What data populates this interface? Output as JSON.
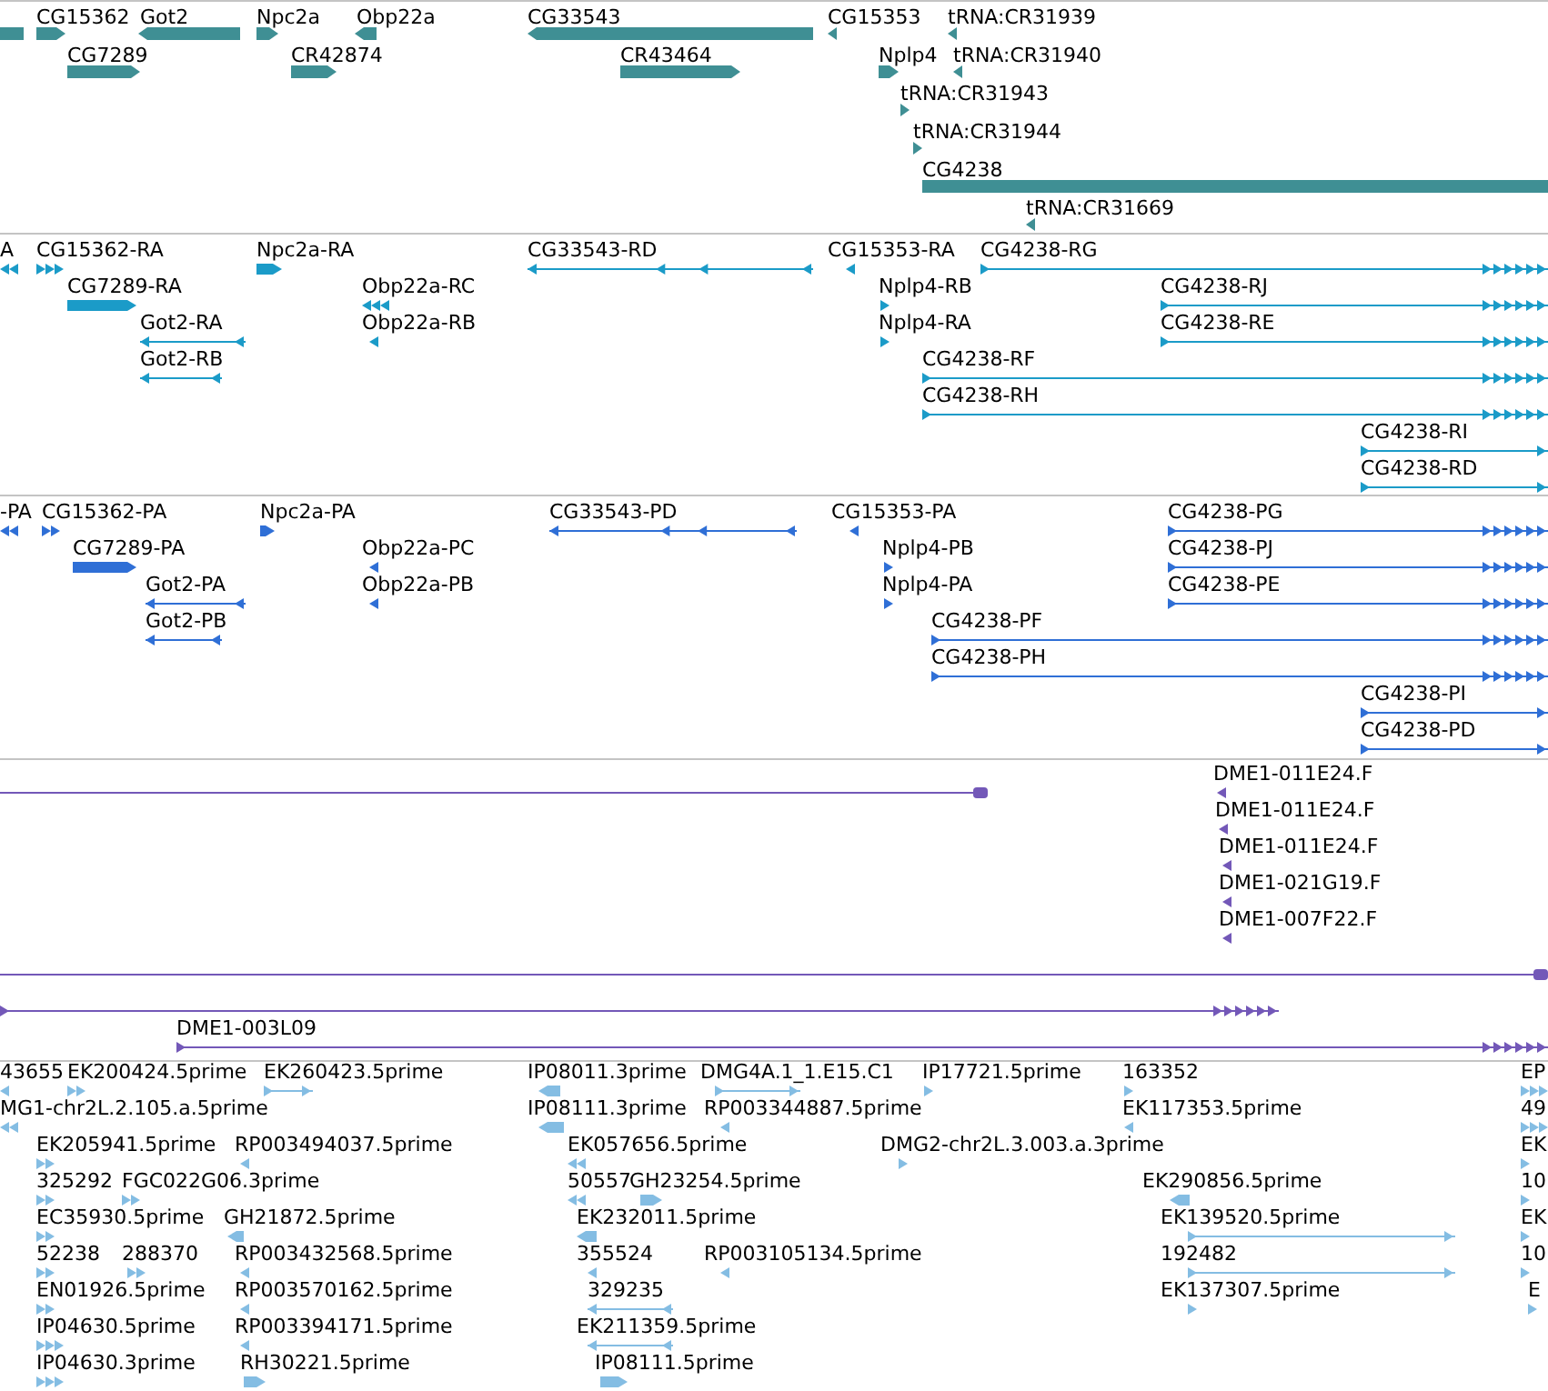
{
  "tracks": [
    {
      "color": "#3f8f94",
      "features": [
        {
          "kind": "plain"
        },
        {
          "label": "CG15362",
          "kind": "forward"
        },
        {
          "label": "Got2",
          "kind": "reverse"
        },
        {
          "label": "Npc2a",
          "kind": "forward"
        },
        {
          "label": "Obp22a",
          "kind": "reverse"
        },
        {
          "label": "CG33543",
          "kind": "reverse"
        },
        {
          "label": "CG15353",
          "kind": "reverse"
        },
        {
          "label": "tRNA:CR31939",
          "kind": "reverse"
        },
        {
          "label": "CG7289",
          "kind": "forward"
        },
        {
          "label": "CR42874",
          "kind": "forward"
        },
        {
          "label": "CR43464",
          "kind": "forward"
        },
        {
          "label": "Nplp4",
          "kind": "forward"
        },
        {
          "label": "tRNA:CR31940",
          "kind": "reverse"
        },
        {
          "label": "tRNA:CR31943",
          "kind": "forward"
        },
        {
          "label": "tRNA:CR31944",
          "kind": "forward"
        },
        {
          "label": "CG4238",
          "kind": "plain"
        },
        {
          "label": "tRNA:CR31669",
          "kind": "reverse"
        }
      ]
    },
    {
      "color": "#1b9bc8",
      "features": [
        {
          "label": "A",
          "kind": "reverse"
        },
        {
          "label": "CG15362-RA",
          "kind": "forward"
        },
        {
          "label": "Npc2a-RA",
          "kind": "forward"
        },
        {
          "label": "CG33543-RD",
          "kind": "reverse"
        },
        {
          "label": "CG15353-RA",
          "kind": "reverse"
        },
        {
          "label": "CG4238-RG",
          "kind": "forward"
        },
        {
          "label": "CG7289-RA",
          "kind": "forward"
        },
        {
          "label": "Obp22a-RC",
          "kind": "reverse"
        },
        {
          "label": "Nplp4-RB",
          "kind": "forward"
        },
        {
          "label": "CG4238-RJ",
          "kind": "forward"
        },
        {
          "label": "Got2-RA",
          "kind": "reverse"
        },
        {
          "label": "Obp22a-RB",
          "kind": "reverse"
        },
        {
          "label": "Nplp4-RA",
          "kind": "forward"
        },
        {
          "label": "CG4238-RE",
          "kind": "forward"
        },
        {
          "label": "Got2-RB",
          "kind": "reverse"
        },
        {
          "label": "CG4238-RF",
          "kind": "forward"
        },
        {
          "label": "CG4238-RH",
          "kind": "forward"
        },
        {
          "label": "CG4238-RI",
          "kind": "forward"
        },
        {
          "label": "CG4238-RD",
          "kind": "forward"
        }
      ]
    },
    {
      "color": "#2f6fd6",
      "features": [
        {
          "label": "-PA",
          "kind": "reverse"
        },
        {
          "label": "CG15362-PA",
          "kind": "forward"
        },
        {
          "label": "Npc2a-PA",
          "kind": "forward"
        },
        {
          "label": "CG33543-PD",
          "kind": "reverse"
        },
        {
          "label": "CG15353-PA",
          "kind": "reverse"
        },
        {
          "label": "CG4238-PG",
          "kind": "forward"
        },
        {
          "label": "CG7289-PA",
          "kind": "forward"
        },
        {
          "label": "Obp22a-PC",
          "kind": "reverse"
        },
        {
          "label": "Nplp4-PB",
          "kind": "forward"
        },
        {
          "label": "CG4238-PJ",
          "kind": "forward"
        },
        {
          "label": "Got2-PA",
          "kind": "reverse"
        },
        {
          "label": "Obp22a-PB",
          "kind": "reverse"
        },
        {
          "label": "Nplp4-PA",
          "kind": "forward"
        },
        {
          "label": "CG4238-PE",
          "kind": "forward"
        },
        {
          "label": "Got2-PB",
          "kind": "reverse"
        },
        {
          "label": "CG4238-PF",
          "kind": "forward"
        },
        {
          "label": "CG4238-PH",
          "kind": "forward"
        },
        {
          "label": "CG4238-PI",
          "kind": "forward"
        },
        {
          "label": "CG4238-PD",
          "kind": "forward"
        }
      ]
    },
    {
      "color": "#7358b8",
      "features": [
        {
          "kind": "plain"
        },
        {
          "label": "DME1-011E24.F",
          "kind": "reverse"
        },
        {
          "label": "DME1-011E24.F",
          "kind": "reverse"
        },
        {
          "label": "DME1-011E24.F",
          "kind": "reverse"
        },
        {
          "label": "DME1-021G19.F",
          "kind": "reverse"
        },
        {
          "label": "DME1-007F22.F",
          "kind": "reverse"
        },
        {
          "kind": "plain"
        },
        {
          "kind": "forward"
        },
        {
          "label": "DME1-003L09",
          "kind": "forward"
        }
      ]
    },
    {
      "color": "#84bde3",
      "features": [
        {
          "label": "43655",
          "kind": "reverse"
        },
        {
          "label": "EK200424.5prime",
          "kind": "forward"
        },
        {
          "label": "EK260423.5prime",
          "kind": "forward"
        },
        {
          "label": "IP08011.3prime",
          "kind": "reverse"
        },
        {
          "label": "DMG4A.1_1.E15.C1",
          "kind": "forward"
        },
        {
          "label": "IP17721.5prime",
          "kind": "forward"
        },
        {
          "label": "163352",
          "kind": "forward"
        },
        {
          "label": "EP",
          "kind": "forward"
        },
        {
          "label": "MG1-chr2L.2.105.a.5prime",
          "kind": "reverse"
        },
        {
          "label": "IP08111.3prime",
          "kind": "reverse"
        },
        {
          "label": "RP003344887.5prime",
          "kind": "reverse"
        },
        {
          "label": "EK117353.5prime",
          "kind": "reverse"
        },
        {
          "label": "49",
          "kind": "forward"
        },
        {
          "label": "EK205941.5prime",
          "kind": "forward"
        },
        {
          "label": "RP003494037.5prime",
          "kind": "reverse"
        },
        {
          "label": "EK057656.5prime",
          "kind": "reverse"
        },
        {
          "label": "DMG2-chr2L.3.003.a.3prime",
          "kind": "forward"
        },
        {
          "label": "EK",
          "kind": "forward"
        },
        {
          "label": "325292",
          "kind": "forward"
        },
        {
          "label": "FGC022G06.3prime",
          "kind": "forward"
        },
        {
          "label": "50557",
          "kind": "reverse"
        },
        {
          "label": "GH23254.5prime",
          "kind": "forward"
        },
        {
          "label": "EK290856.5prime",
          "kind": "reverse"
        },
        {
          "label": "10",
          "kind": "forward"
        },
        {
          "label": "EC35930.5prime",
          "kind": "forward"
        },
        {
          "label": "GH21872.5prime",
          "kind": "reverse"
        },
        {
          "label": "EK232011.5prime",
          "kind": "reverse"
        },
        {
          "label": "EK139520.5prime",
          "kind": "forward"
        },
        {
          "label": "EK",
          "kind": "forward"
        },
        {
          "label": "52238",
          "kind": "forward"
        },
        {
          "label": "288370",
          "kind": "forward"
        },
        {
          "label": "RP003432568.5prime",
          "kind": "reverse"
        },
        {
          "label": "355524",
          "kind": "reverse"
        },
        {
          "label": "RP003105134.5prime",
          "kind": "reverse"
        },
        {
          "label": "192482",
          "kind": "forward"
        },
        {
          "label": "10",
          "kind": "forward"
        },
        {
          "label": "EN01926.5prime",
          "kind": "forward"
        },
        {
          "label": "RP003570162.5prime",
          "kind": "reverse"
        },
        {
          "label": "329235",
          "kind": "reverse"
        },
        {
          "label": "EK137307.5prime",
          "kind": "forward"
        },
        {
          "label": "E",
          "kind": "forward"
        },
        {
          "label": "IP04630.5prime",
          "kind": "forward"
        },
        {
          "label": "RP003394171.5prime",
          "kind": "reverse"
        },
        {
          "label": "EK211359.5prime",
          "kind": "reverse"
        },
        {
          "label": "IP04630.3prime",
          "kind": "forward"
        },
        {
          "label": "RH30221.5prime",
          "kind": "forward"
        },
        {
          "label": "IP08111.5prime",
          "kind": "forward"
        }
      ]
    }
  ]
}
